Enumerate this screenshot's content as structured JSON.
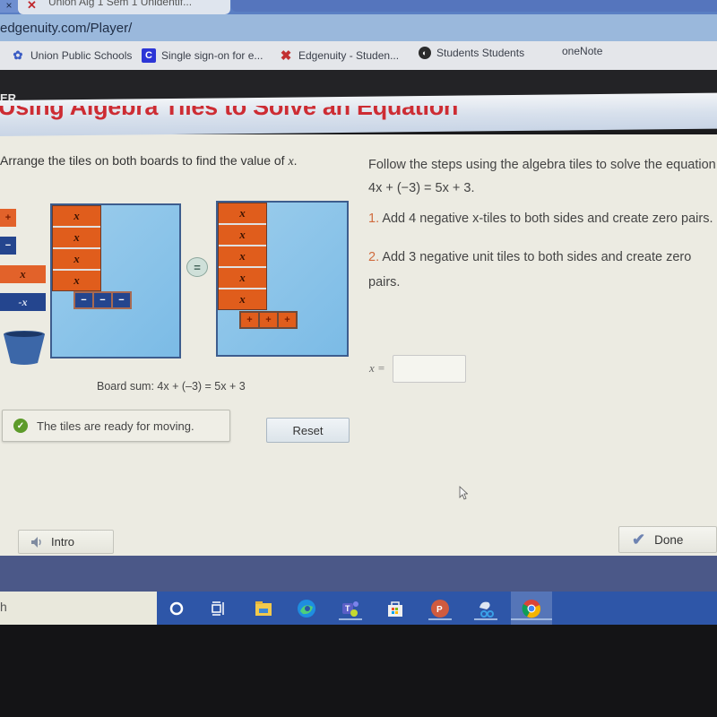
{
  "browser": {
    "active_tab_title": "Union Alg 1 Sem 1 Unidentif...",
    "tab_close_glyph": "×",
    "url": "edgenuity.com/Player/",
    "bookmarks": [
      {
        "label": "Union Public Schools",
        "icon": "union-schools-icon"
      },
      {
        "label": "Single sign-on for e...",
        "icon": "classlink-c-icon"
      },
      {
        "label": "Edgenuity - Studen...",
        "icon": "edgenuity-x-icon"
      },
      {
        "label": "Students Students",
        "icon": "globe-icon"
      },
      {
        "label": "oneNote",
        "icon": "onenote-icon"
      }
    ]
  },
  "app": {
    "header_label": "ER",
    "lesson_title": "Using Algebra Tiles to Solve an Equation"
  },
  "activity": {
    "instruction_prefix": "Arrange the tiles on both boards to find the value of ",
    "instruction_var": "x",
    "instruction_suffix": ".",
    "palette": {
      "plus": "+",
      "minus": "−",
      "x": "x",
      "neg_x": "-x"
    },
    "left_board": {
      "x_tiles": [
        "x",
        "x",
        "x",
        "x"
      ],
      "unit_tiles": [
        "−",
        "−",
        "−"
      ]
    },
    "equals": "=",
    "right_board": {
      "x_tiles": [
        "x",
        "x",
        "x",
        "x",
        "x"
      ],
      "unit_tiles": [
        "+",
        "+",
        "+"
      ]
    },
    "board_sum": "Board sum: 4x + (–3) = 5x + 3",
    "status_message": "The tiles are ready for moving.",
    "reset_label": "Reset",
    "answer_label": "x =",
    "answer_value": "",
    "answer_placeholder": ""
  },
  "steps_panel": {
    "intro": "Follow the steps using the algebra tiles to solve the equation 4x + (−3) = 5x + 3.",
    "steps": [
      {
        "num": "1.",
        "text": " Add 4 negative x-tiles to both sides and create zero pairs."
      },
      {
        "num": "2.",
        "text": " Add 3 negative unit tiles to both sides and create zero pairs."
      }
    ]
  },
  "footer": {
    "intro_label": "Intro",
    "done_label": "Done",
    "done_glyph": "✔"
  },
  "taskbar": {
    "search_text": "h",
    "icons": [
      "cortana-icon",
      "task-view-icon",
      "file-explorer-icon",
      "edge-icon",
      "teams-icon",
      "store-icon",
      "powerpoint-icon",
      "snip-sketch-icon",
      "chrome-icon"
    ]
  }
}
